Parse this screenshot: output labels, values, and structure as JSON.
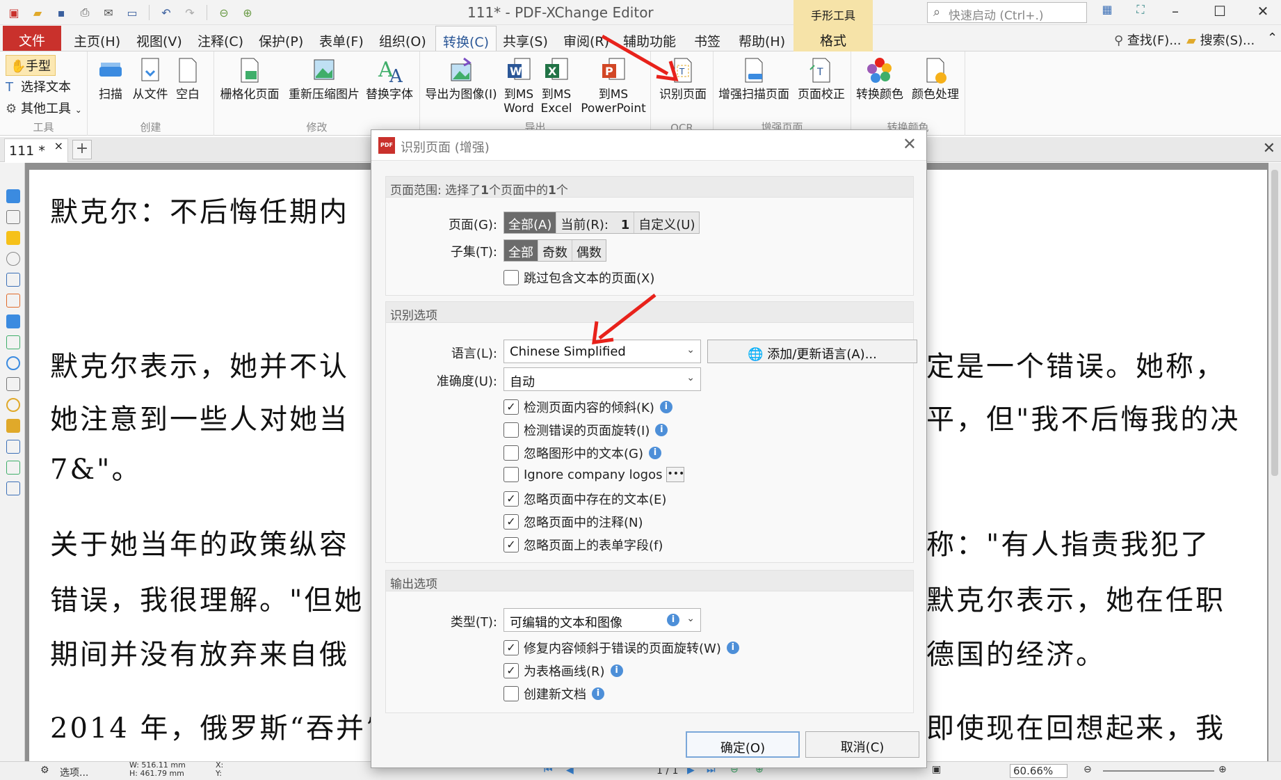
{
  "app": {
    "title": "111* - PDF-XChange Editor",
    "context_tab_title": "手形工具",
    "quick_launch_placeholder": "快速启动 (Ctrl+.)"
  },
  "ribbon_tabs": {
    "file": "文件",
    "tabs": [
      "主页(H)",
      "视图(V)",
      "注释(C)",
      "保护(P)",
      "表单(F)",
      "组织(O)",
      "转换(C)",
      "共享(S)",
      "审阅(R)",
      "辅助功能",
      "书签",
      "帮助(H)"
    ],
    "active": "转换(C)",
    "context_tab": "格式",
    "find": "查找(F)...",
    "search": "搜索(S)..."
  },
  "ribbon": {
    "tools_group": {
      "hand": "手型",
      "select_text": "选择文本",
      "other_tools": "其他工具",
      "label": "工具"
    },
    "create_group": {
      "scan": "扫描",
      "from_file": "从文件",
      "blank": "空白",
      "label": "创建"
    },
    "modify_group": {
      "rasterize": "栅格化页面",
      "recompress": "重新压缩图片",
      "replace_font": "替换字体",
      "label": "修改"
    },
    "export_group": {
      "to_image": "导出为图像(I)",
      "to_word_1": "到MS",
      "to_word_2": "Word",
      "to_excel_1": "到MS",
      "to_excel_2": "Excel",
      "to_ppt_1": "到MS",
      "to_ppt_2": "PowerPoint",
      "label": "导出"
    },
    "ocr_group": {
      "ocr_page": "识别页面",
      "label": "OCR"
    },
    "enhance_group": {
      "enhance_scan": "增强扫描页面",
      "page_correct": "页面校正",
      "label": "增强页面"
    },
    "color_group": {
      "convert_color": "转换颜色",
      "color_process": "颜色处理",
      "label": "转换颜色"
    }
  },
  "doc_tab": {
    "name": "111",
    "modified": "*"
  },
  "document": {
    "lines": [
      "默克尔：不后悔任期内",
      "默克尔表示，她并不认",
      "定是一个错误。她称，",
      "她注意到一些人对她当",
      "平，但\"我不后悔我的决",
      "7&\"。",
      "关于她当年的政策纵容",
      "称：\"有人指责我犯了",
      "错误，我很理解。\"但她",
      "默克尔表示，她在任职",
      "期间并没有放弃来自俄",
      "德国的经济。",
      "2014 年，俄罗斯“吞并”",
      "即使现在回想起来，我"
    ]
  },
  "statusbar": {
    "options": "选项...",
    "width": "W: 516.11 mm",
    "height": "H: 461.79 mm",
    "x": "X:",
    "y": "Y:",
    "page": "1 / 1",
    "zoom": "60.66%"
  },
  "dialog": {
    "title": "识别页面 (增强)",
    "page_range": {
      "header_prefix": "页面范围: 选择了",
      "header_count1": "1",
      "header_mid": "个页面中的",
      "header_count2": "1",
      "header_suffix": "个",
      "pages_label": "页面(G):",
      "pages_all": "全部(A)",
      "pages_current": "当前(R):",
      "pages_current_value": "1",
      "pages_custom": "自定义(U)",
      "subset_label": "子集(T):",
      "subset_all": "全部",
      "subset_odd": "奇数",
      "subset_even": "偶数",
      "skip_text_pages": "跳过包含文本的页面(X)"
    },
    "recognition": {
      "header": "识别选项",
      "language_label": "语言(L):",
      "language_value": "Chinese Simplified",
      "add_update_lang": "添加/更新语言(A)...",
      "accuracy_label": "准确度(U):",
      "accuracy_value": "自动",
      "options": [
        {
          "label": "检测页面内容的倾斜(K)",
          "checked": true,
          "info": true
        },
        {
          "label": "检测错误的页面旋转(I)",
          "checked": false,
          "info": true
        },
        {
          "label": "忽略图形中的文本(G)",
          "checked": false,
          "info": true
        },
        {
          "label": "Ignore company logos",
          "checked": false,
          "more": true
        },
        {
          "label": "忽略页面中存在的文本(E)",
          "checked": true
        },
        {
          "label": "忽略页面中的注释(N)",
          "checked": true
        },
        {
          "label": "忽略页面上的表单字段(f)",
          "checked": true
        }
      ]
    },
    "output": {
      "header": "输出选项",
      "type_label": "类型(T):",
      "type_value": "可编辑的文本和图像",
      "options": [
        {
          "label": "修复内容倾斜于错误的页面旋转(W)",
          "checked": true,
          "info": true
        },
        {
          "label": "为表格画线(R)",
          "checked": true,
          "info": true
        },
        {
          "label": "创建新文档",
          "checked": false,
          "info": true
        }
      ]
    },
    "ok": "确定(O)",
    "cancel": "取消(C)"
  },
  "colors": {
    "file_tab": "#c9312c",
    "arrow": "#e8221b",
    "context_tab": "#f6e3a8",
    "info": "#4d8fd8"
  }
}
